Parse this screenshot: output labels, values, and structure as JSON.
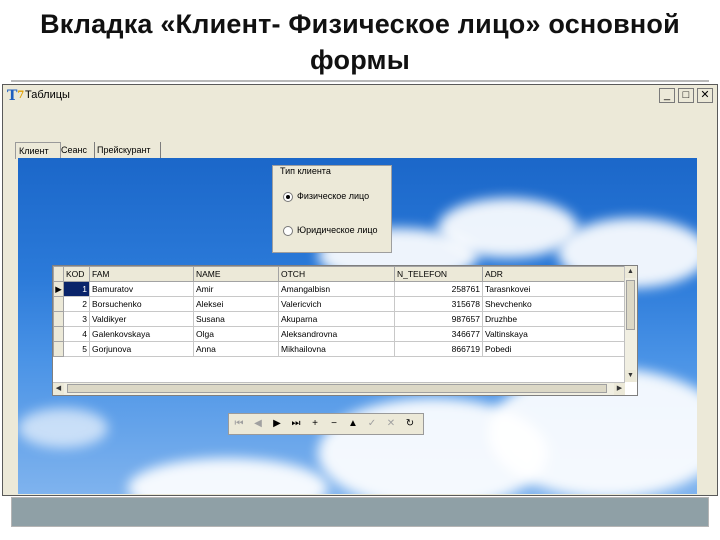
{
  "slide": {
    "title_line1": "Вкладка «Клиент- Физическое лицо» основной",
    "title_line2": "формы"
  },
  "window": {
    "title": "Таблицы",
    "icon": "delphi-app-icon",
    "buttons": {
      "minimize": "minimize-icon",
      "maximize": "maximize-icon",
      "close": "close-icon"
    }
  },
  "tabs": [
    {
      "label": "Клиент",
      "active": true
    },
    {
      "label": "Сеанс",
      "active": false
    },
    {
      "label": "Прейскурант",
      "active": false
    }
  ],
  "client_type": {
    "caption": "Тип клиента",
    "options": [
      {
        "label": "Физическое лицо",
        "selected": true
      },
      {
        "label": "Юридическое лицо",
        "selected": false
      }
    ]
  },
  "grid": {
    "columns": [
      "KOD",
      "FAM",
      "NAME",
      "OTCH",
      "N_TELEFON",
      "ADR"
    ],
    "rows": [
      [
        "1",
        "Bamuratov",
        "Amir",
        "Amangalbisn",
        "258761",
        "Tarasnkovei"
      ],
      [
        "2",
        "Borsuchenko",
        "Aleksei",
        "Valericvich",
        "315678",
        "Shevchenko"
      ],
      [
        "3",
        "Valdikyer",
        "Susana",
        "Akuparna",
        "987657",
        "Druzhbe"
      ],
      [
        "4",
        "Galenkovskaya",
        "Olga",
        "Aleksandrovna",
        "346677",
        "Valtinskaya"
      ],
      [
        "5",
        "Gorjunova",
        "Anna",
        "Mikhailovna",
        "866719",
        "Pobedi"
      ]
    ],
    "selected_row": 0
  },
  "navigator": {
    "buttons": [
      {
        "name": "first-record",
        "glyph": "⏮",
        "enabled": false
      },
      {
        "name": "prior-record",
        "glyph": "◀",
        "enabled": false
      },
      {
        "name": "next-record",
        "glyph": "▶",
        "enabled": true
      },
      {
        "name": "last-record",
        "glyph": "⏭",
        "enabled": true
      },
      {
        "name": "insert-record",
        "glyph": "+",
        "enabled": true
      },
      {
        "name": "delete-record",
        "glyph": "−",
        "enabled": true
      },
      {
        "name": "edit-record",
        "glyph": "▲",
        "enabled": true
      },
      {
        "name": "post-edit",
        "glyph": "✓",
        "enabled": false
      },
      {
        "name": "cancel-edit",
        "glyph": "✕",
        "enabled": false
      },
      {
        "name": "refresh-data",
        "glyph": "↻",
        "enabled": true
      }
    ]
  },
  "colors": {
    "selection": "#0a246a",
    "form_face": "#ece9d8",
    "sky_top": "#1b67c9"
  }
}
